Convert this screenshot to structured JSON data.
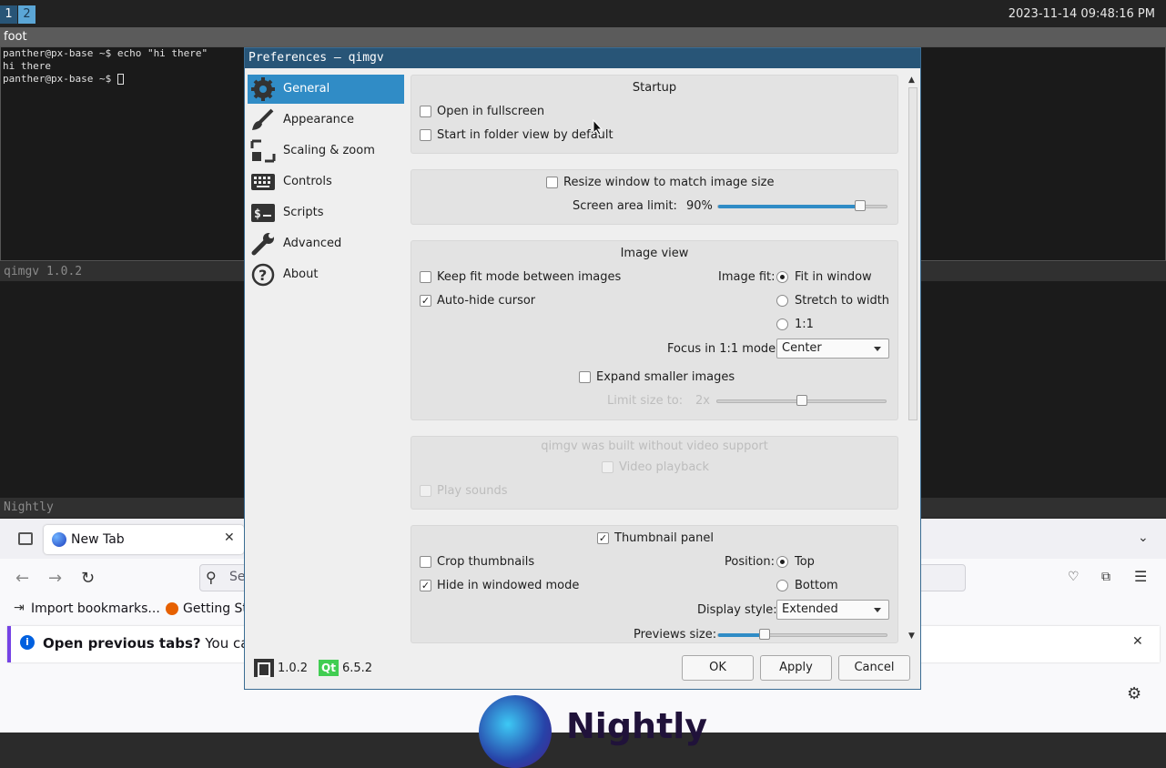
{
  "bar": {
    "workspaces": [
      "1",
      "2"
    ],
    "clock": "2023-11-14 09:48:16 PM"
  },
  "terminal": {
    "title": "foot",
    "lines": [
      "panther@px-base ~$ echo \"hi there\"",
      "hi there",
      "panther@px-base ~$ "
    ]
  },
  "qimgv_window": {
    "title": "qimgv 1.0.2"
  },
  "nightly_window": {
    "title": "Nightly"
  },
  "firefox": {
    "tab_label": "New Tab",
    "url_placeholder": "Se",
    "bookmarks": [
      "Import bookmarks...",
      "Getting St"
    ],
    "notice_bold": "Open previous tabs?",
    "notice_rest": "You can re",
    "wordmark": "Nightly"
  },
  "dialog": {
    "title": "Preferences — qimgv",
    "sidebar": [
      {
        "label": "General",
        "icon": "gear-icon"
      },
      {
        "label": "Appearance",
        "icon": "brush-icon"
      },
      {
        "label": "Scaling & zoom",
        "icon": "resize-icon"
      },
      {
        "label": "Controls",
        "icon": "keyboard-icon"
      },
      {
        "label": "Scripts",
        "icon": "terminal-icon"
      },
      {
        "label": "Advanced",
        "icon": "wrench-icon"
      },
      {
        "label": "About",
        "icon": "help-icon"
      }
    ],
    "startup": {
      "title": "Startup",
      "open_fullscreen": "Open in fullscreen",
      "folder_view": "Start in folder view by default"
    },
    "window": {
      "resize_label": "Resize window to match image size",
      "screen_limit_label": "Screen area limit:",
      "screen_limit_value": "90%",
      "screen_limit_fraction": 0.9
    },
    "image_view": {
      "title": "Image view",
      "keep_fit": "Keep fit mode between images",
      "autohide": "Auto-hide cursor",
      "image_fit_label": "Image fit:",
      "fit_options": [
        "Fit in window",
        "Stretch to width",
        "1:1"
      ],
      "focus_label": "Focus in 1:1 mode:",
      "focus_value": "Center",
      "expand_smaller": "Expand smaller images",
      "limit_label": "Limit size to:",
      "limit_value": "2x",
      "limit_fraction": 0.5
    },
    "video": {
      "notice": "qimgv was built without video support",
      "video_playback": "Video playback",
      "play_sounds": "Play sounds"
    },
    "thumbnails": {
      "title": "Thumbnail panel",
      "crop": "Crop thumbnails",
      "hide_windowed": "Hide in windowed mode",
      "position_label": "Position:",
      "position_options": [
        "Top",
        "Bottom"
      ],
      "display_label": "Display style:",
      "display_value": "Extended",
      "previews_label": "Previews size:",
      "previews_fraction": 0.28
    },
    "footer": {
      "app_version": "1.0.2",
      "qt_badge": "Qt",
      "qt_version": "6.5.2",
      "ok": "OK",
      "apply": "Apply",
      "cancel": "Cancel"
    }
  }
}
